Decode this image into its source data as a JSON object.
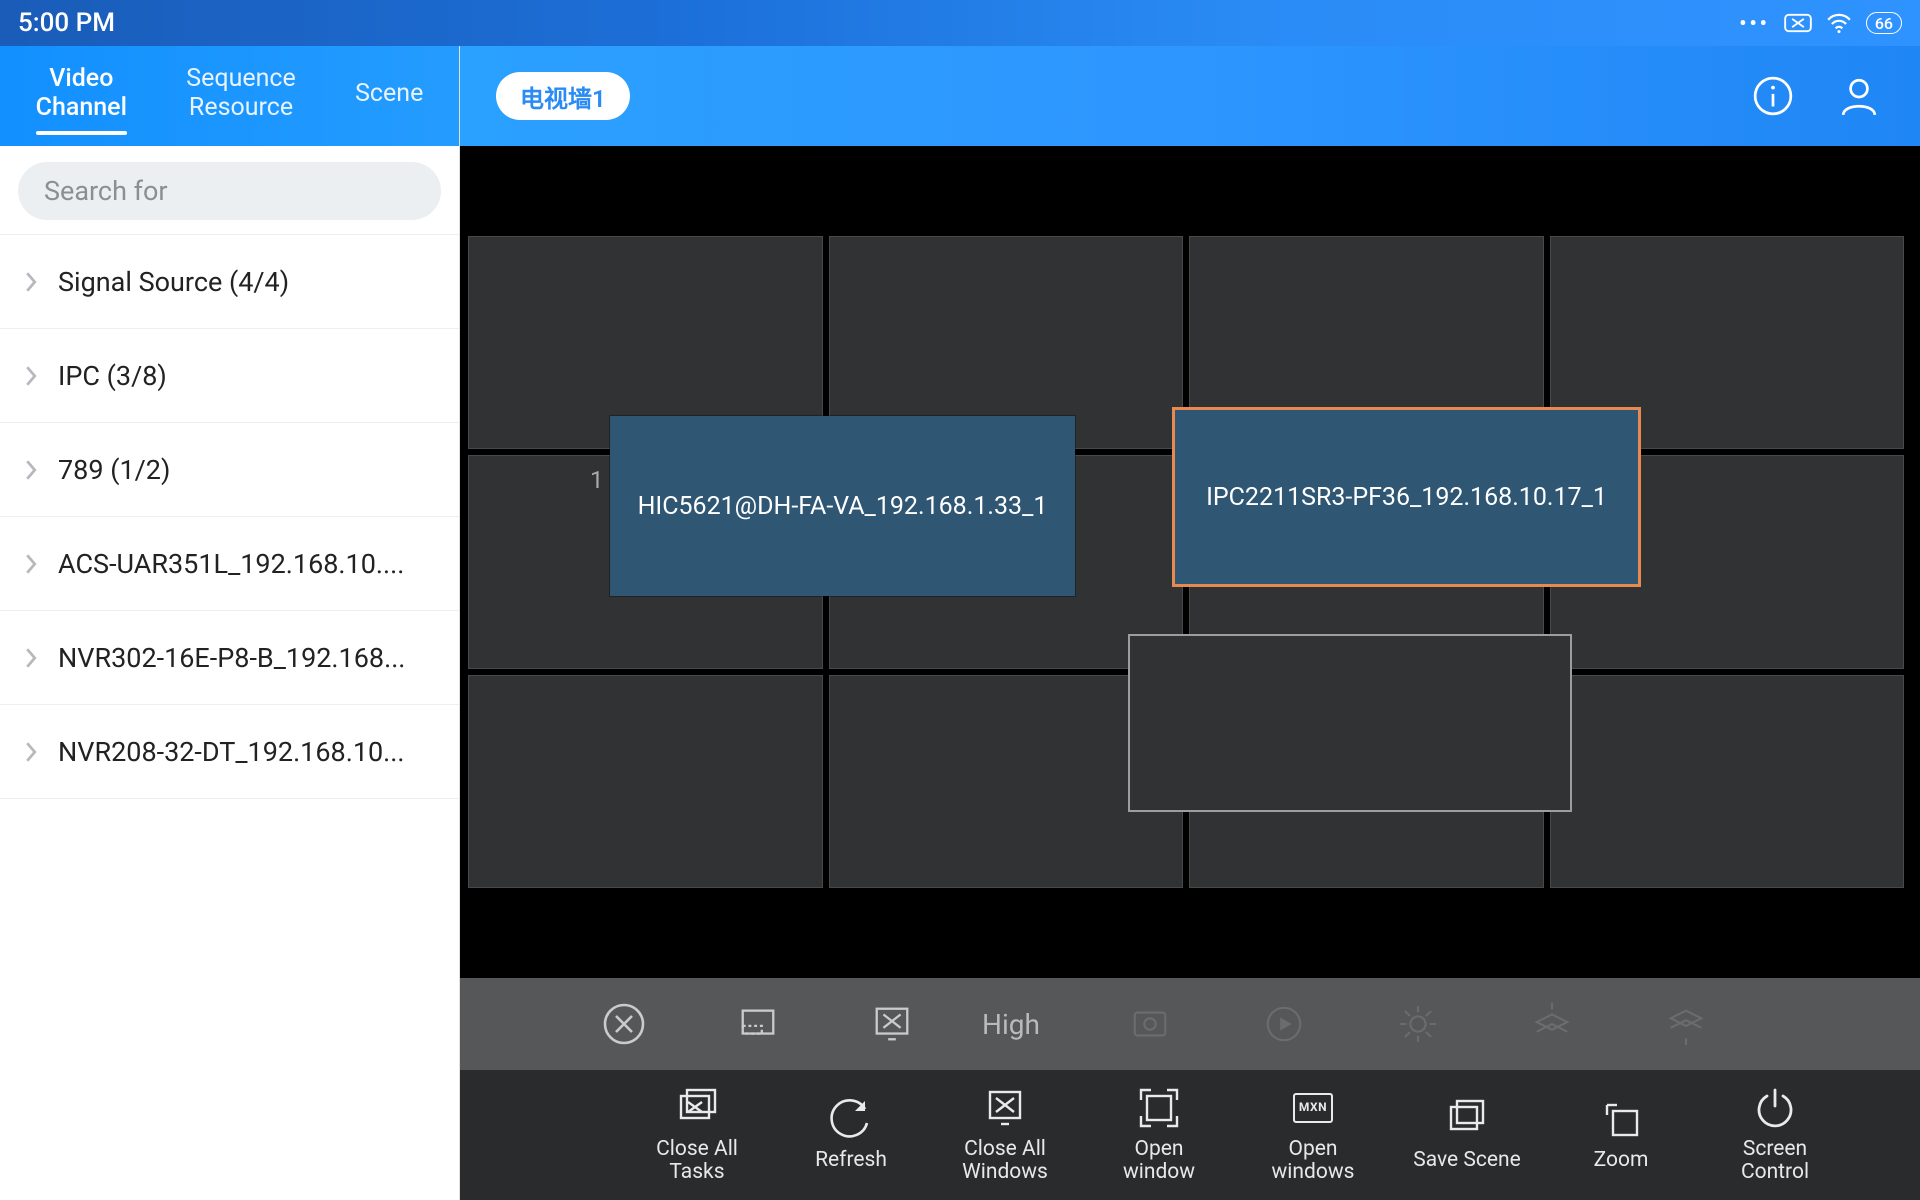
{
  "status": {
    "time": "5:00 PM",
    "battery": "66"
  },
  "sidebar": {
    "tabs": [
      {
        "label": "Video\nChannel",
        "active": true
      },
      {
        "label": "Sequence\nResource",
        "active": false
      },
      {
        "label": "Scene",
        "active": false
      }
    ],
    "search_placeholder": "Search for",
    "items": [
      {
        "label": "Signal Source (4/4)"
      },
      {
        "label": "IPC (3/8)"
      },
      {
        "label": "789 (1/2)"
      },
      {
        "label": "ACS-UAR351L_192.168.10...."
      },
      {
        "label": "NVR302-16E-P8-B_192.168..."
      },
      {
        "label": "NVR208-32-DT_192.168.10..."
      }
    ]
  },
  "header": {
    "wall_chip": "电视墙1"
  },
  "wall": {
    "label_1": "1",
    "windows": [
      {
        "label": "HIC5621@DH-FA-VA_192.168.1.33_1",
        "selected": false
      },
      {
        "label": "IPC2211SR3-PF36_192.168.10.17_1",
        "selected": true
      }
    ]
  },
  "midbar": {
    "high_label": "High"
  },
  "bottom": {
    "items": [
      {
        "label": "Close All\nTasks"
      },
      {
        "label": "Refresh"
      },
      {
        "label": "Close All\nWindows"
      },
      {
        "label": "Open\nwindow"
      },
      {
        "label": "Open\nwindows"
      },
      {
        "label": "Save Scene"
      },
      {
        "label": "Zoom"
      },
      {
        "label": "Screen\nControl"
      }
    ],
    "mxn": "MXN"
  }
}
